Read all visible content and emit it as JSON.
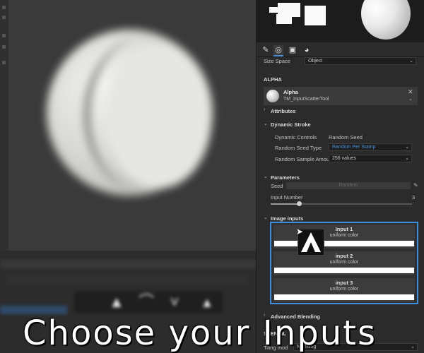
{
  "caption": "Choose your Inputs",
  "colors": {
    "accent": "#3d8ee0",
    "link": "#4a90d9"
  },
  "viewport": {
    "object": "blurred sphere render"
  },
  "bottom_panel": {
    "thumb_icons": [
      "arrow-icon",
      "arch-icon",
      "chevron-icon",
      "spike-icon"
    ]
  },
  "properties": {
    "tabs": [
      "brush-icon",
      "texture-icon",
      "stamp-icon",
      "material-icon"
    ],
    "size_space": {
      "label": "Size Space",
      "value": "Object"
    },
    "alpha": {
      "section": "ALPHA",
      "name": "Alpha",
      "resource": "TM_InputScatterTool"
    },
    "attributes": {
      "label": "Attributes"
    },
    "dynamic_stroke": {
      "label": "Dynamic Stroke",
      "controls_label": "Dynamic Controls",
      "controls_value": "Random Seed",
      "seed_type_label": "Random Seed Type",
      "seed_type_value": "Random Per Stamp",
      "sample_label": "Random Sample Amount",
      "sample_value": "256 values"
    },
    "parameters": {
      "label": "Parameters",
      "seed_label": "Seed",
      "seed_button": "Random",
      "input_number_label": "Input Number",
      "input_number_value": "3",
      "input_number_fraction": 0.2
    },
    "image_inputs": {
      "label": "Image inputs",
      "items": [
        {
          "title": "Input 1",
          "subtitle": "uniform color"
        },
        {
          "title": "input 2",
          "subtitle": "uniform color"
        },
        {
          "title": "input 3",
          "subtitle": "uniform color"
        }
      ]
    },
    "advanced_blending": {
      "label": "Advanced Blending"
    },
    "stencil": {
      "label": "STENCIL",
      "tiling_label": "Tiling mod",
      "tiling_value": "No Tiling"
    }
  }
}
